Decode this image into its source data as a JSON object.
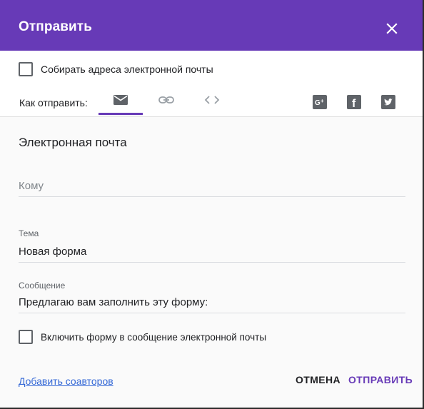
{
  "header": {
    "title": "Отправить"
  },
  "options": {
    "collect_emails_label": "Собирать адреса электронной почты",
    "collect_emails_checked": false
  },
  "send_via": {
    "label": "Как отправить:",
    "tabs": [
      {
        "icon": "email-icon",
        "active": true
      },
      {
        "icon": "link-icon",
        "active": false
      },
      {
        "icon": "embed-code-icon",
        "active": false
      }
    ],
    "social": [
      "google-plus-icon",
      "facebook-icon",
      "twitter-icon"
    ]
  },
  "email": {
    "section_title": "Электронная почта",
    "to_placeholder": "Кому",
    "subject_label": "Тема",
    "subject_value": "Новая форма",
    "message_label": "Сообщение",
    "message_value": "Предлагаю вам заполнить эту форму:",
    "include_form_label": "Включить форму в сообщение электронной почты",
    "include_form_checked": false
  },
  "footer": {
    "add_collaborators_link": "Добавить соавторов",
    "cancel_label": "ОТМЕНА",
    "send_label": "ОТПРАВИТЬ"
  },
  "colors": {
    "accent": "#673ab7",
    "link": "#3367d6"
  }
}
